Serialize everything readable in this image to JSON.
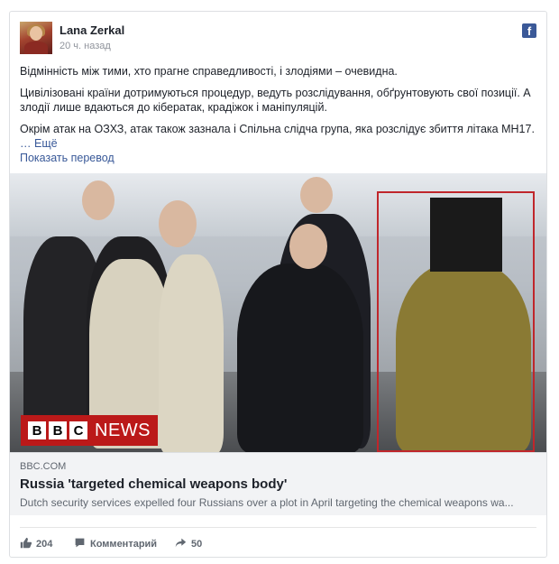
{
  "post": {
    "author": "Lana Zerkal",
    "time": "20 ч. назад",
    "paragraphs": [
      "Відмінність між тими, хто прагне справедливості, і злодіями – очевидна.",
      "Цивілізовані країни дотримуються процедур, ведуть розслідування, обґрунтовують свої позиції. А злодії лише вдаються до кібератак, крадіжок і маніпуляцій.",
      "Окрім атак на ОЗХЗ, атак також зазнала і Спільна слідча група, яка розслідує збиття літака MH17."
    ],
    "more_prefix": "…",
    "more_label": "Ещё",
    "translate_label": "Показать перевод"
  },
  "media": {
    "logo_text": "NEWS",
    "logo_letters": [
      "B",
      "B",
      "C"
    ]
  },
  "link": {
    "domain": "BBC.COM",
    "headline": "Russia 'targeted chemical weapons body'",
    "description": "Dutch security services expelled four Russians over a plot in April targeting the chemical weapons wa..."
  },
  "actions": {
    "likes": "204",
    "comment_label": "Комментарий",
    "shares": "50"
  },
  "icons": {
    "facebook": "facebook-icon",
    "like": "thumbs-up-icon",
    "comment": "comment-icon",
    "share": "share-arrow-icon"
  }
}
